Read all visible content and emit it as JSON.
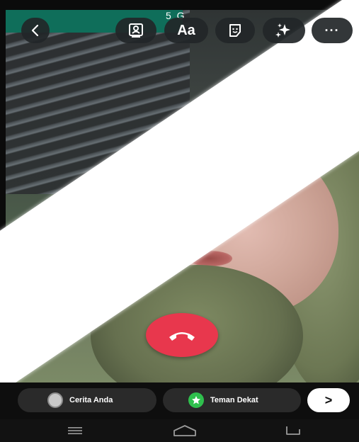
{
  "status_bar": {
    "text": "5 G"
  },
  "toolbar": {
    "back_icon": "chevron-left-icon",
    "items": [
      {
        "name": "contact-card-icon"
      },
      {
        "label": "Aa"
      },
      {
        "name": "sticker-icon"
      },
      {
        "name": "sparkles-icon"
      },
      {
        "label": "···"
      }
    ]
  },
  "call": {
    "end_icon": "phone-hangup-icon",
    "end_color": "#e8374d"
  },
  "share": {
    "story_label": "Cerita Anda",
    "close_friends_label": "Teman Dekat",
    "close_friends_color": "#2fbf4d",
    "next_label": ">"
  },
  "nav": {
    "recents_icon": "recents-icon",
    "home_icon": "home-icon",
    "back_icon": "back-icon"
  }
}
